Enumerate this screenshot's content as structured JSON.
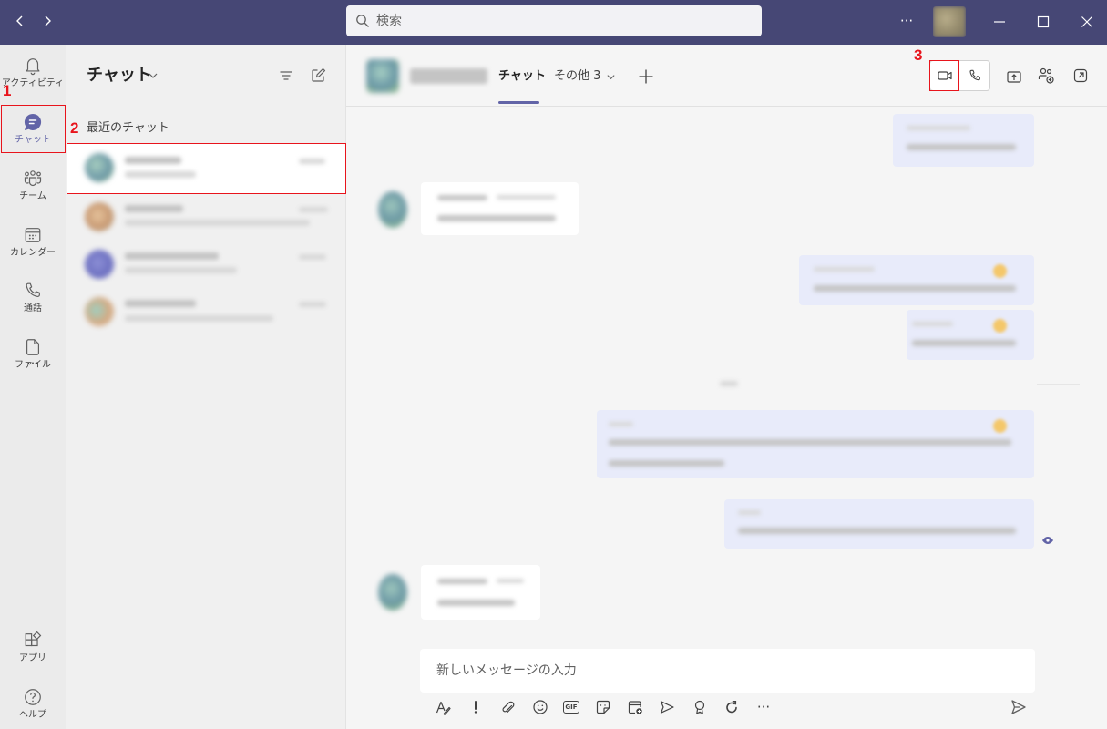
{
  "titlebar": {
    "back_icon": "chevron-left-icon",
    "forward_icon": "chevron-right-icon",
    "search_icon": "search-icon",
    "search_placeholder": "検索",
    "more": "···"
  },
  "rail": {
    "items": [
      {
        "label": "アクティビティ",
        "icon": "bell-icon",
        "selected": false
      },
      {
        "label": "チャット",
        "icon": "chat-icon",
        "selected": true
      },
      {
        "label": "チーム",
        "icon": "teams-icon",
        "selected": false
      },
      {
        "label": "カレンダー",
        "icon": "calendar-icon",
        "selected": false
      },
      {
        "label": "通話",
        "icon": "phone-icon",
        "selected": false
      },
      {
        "label": "ファイル",
        "icon": "file-icon",
        "selected": false
      }
    ],
    "more": "···",
    "bottom_items": [
      {
        "label": "アプリ",
        "icon": "apps-icon"
      },
      {
        "label": "ヘルプ",
        "icon": "help-icon"
      }
    ]
  },
  "chat_list": {
    "title": "チャット",
    "section_title": "最近のチャット"
  },
  "conversation": {
    "tabs": [
      {
        "label": "チャット",
        "active": true
      },
      {
        "label": "その他 3",
        "active": false
      }
    ],
    "compose_placeholder": "新しいメッセージの入力",
    "toolbar": {
      "gif_label": "GIF",
      "more": "···"
    }
  },
  "annotations": {
    "rail_chat": "1",
    "recent_chat": "2",
    "video_call": "3"
  },
  "colors": {
    "titlebar": "#464775",
    "accent": "#6264a7",
    "annotation": "#e8141c",
    "outgoing_bubble": "#e8ebfa",
    "incoming_bubble": "#ffffff"
  }
}
